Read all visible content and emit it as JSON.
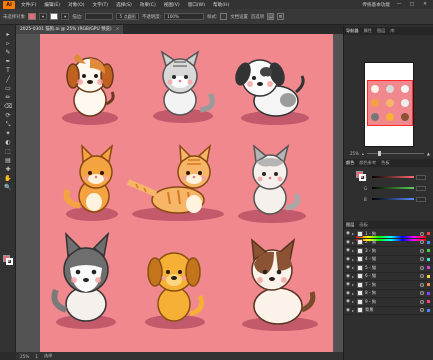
{
  "app": {
    "logo": "Ai"
  },
  "menu": {
    "items": [
      "文件(F)",
      "编辑(E)",
      "对象(O)",
      "文字(T)",
      "选择(S)",
      "效果(C)",
      "视图(V)",
      "窗口(W)",
      "帮助(H)"
    ],
    "right": {
      "workspace": "传统基本功能"
    },
    "window_buttons": [
      "—",
      "□",
      "✕"
    ]
  },
  "control_bar": {
    "selection_label": "未选择对象",
    "stroke_label": "描边:",
    "stroke_profile": "5 点圆形",
    "opacity_label": "不透明度:",
    "opacity_value": "100%",
    "style_label": "样式:",
    "doc_setup": "文档设置",
    "preferences": "首选项",
    "fill_color": "#e06a7a",
    "stroke_color": "#ffffff"
  },
  "document": {
    "tab_title": "2025-0301 猫狗.ai @ 25% (RGB/GPU 预览)",
    "close": "×",
    "artboard_color": "#f0888e",
    "shadow_color": "#c25a6c"
  },
  "status": {
    "zoom": "25%",
    "page": "1",
    "tool": "选择"
  },
  "tools": [
    "▸",
    "▹",
    "✎",
    "✒",
    "T",
    "╱",
    "▭",
    "✏",
    "⌫",
    "⟳",
    "⤡",
    "✦",
    "◐",
    "⬚",
    "▤",
    "✚",
    "✋",
    "🔍"
  ],
  "panels": {
    "navigator_tabs": [
      "导航器",
      "属性",
      "图层",
      "库"
    ],
    "navigator_zoom": "25%",
    "color_tabs": [
      "颜色",
      "颜色参考",
      "色板"
    ],
    "color_sliders": [
      {
        "label": "R",
        "color": "#ff6b6b"
      },
      {
        "label": "G",
        "color": "#5ad35a"
      },
      {
        "label": "B",
        "color": "#5a8aff"
      }
    ],
    "layers_tabs": [
      "图层",
      "画板"
    ]
  },
  "layers": [
    {
      "name": "1 - 狗"
    },
    {
      "name": "2 - 猫"
    },
    {
      "name": "3 - 狗"
    },
    {
      "name": "4 - 猫"
    },
    {
      "name": "5 - 猫"
    },
    {
      "name": "6 - 猫"
    },
    {
      "name": "7 - 狗"
    },
    {
      "name": "8 - 狗"
    },
    {
      "name": "9 - 狗"
    },
    {
      "name": "背景"
    }
  ]
}
